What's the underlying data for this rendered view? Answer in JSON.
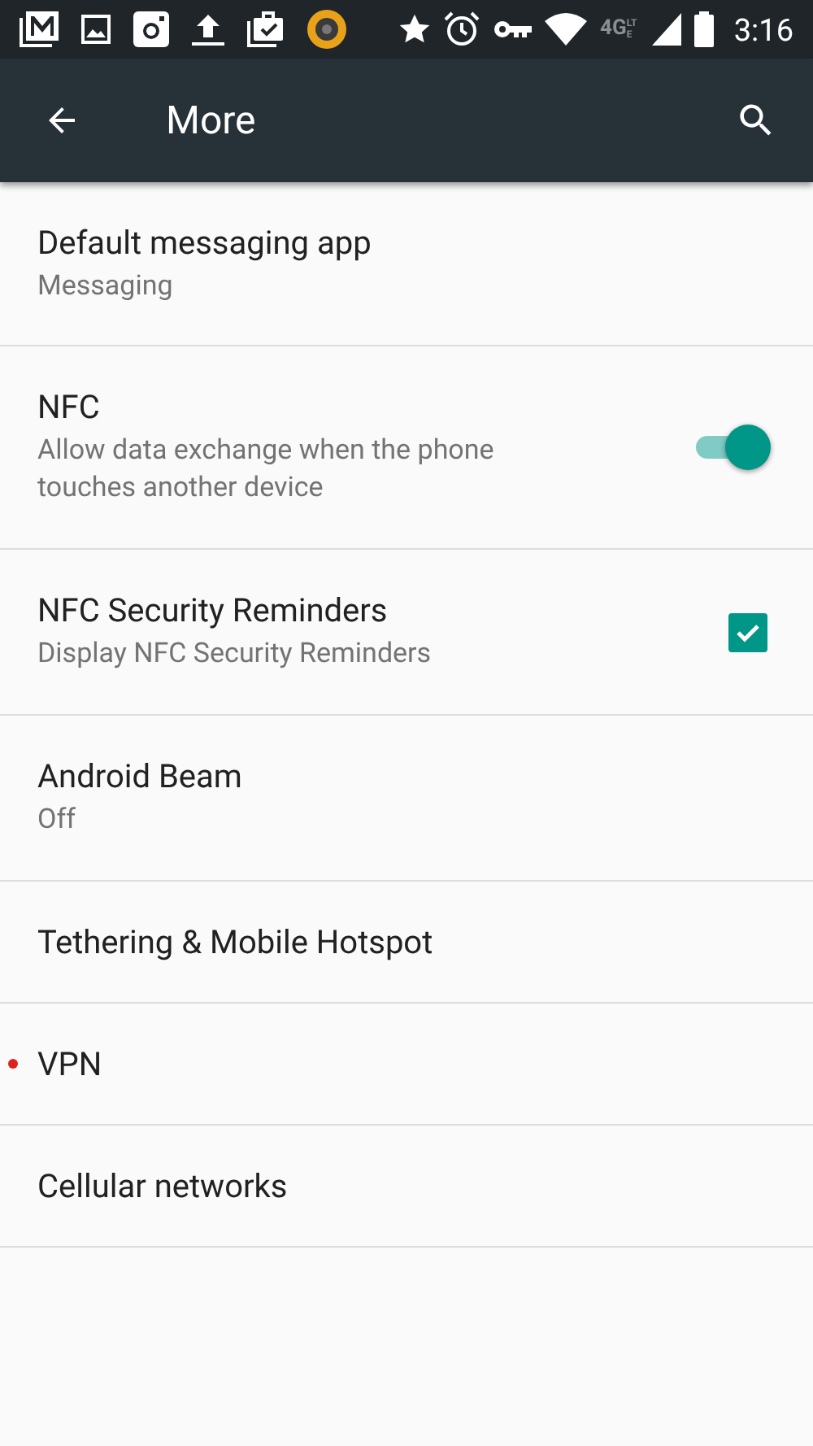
{
  "status_bar": {
    "network": "4G",
    "network_sub": "LTE",
    "time": "3:16"
  },
  "toolbar": {
    "title": "More"
  },
  "items": [
    {
      "kind": "text",
      "title": "Default messaging app",
      "summary": "Messaging",
      "alert": false
    },
    {
      "kind": "switch",
      "title": "NFC",
      "summary": "Allow data exchange when the phone touches another device",
      "on": true,
      "alert": false
    },
    {
      "kind": "checkbox",
      "title": "NFC Security Reminders",
      "summary": "Display NFC Security Reminders",
      "checked": true,
      "alert": false
    },
    {
      "kind": "text",
      "title": "Android Beam",
      "summary": "Off",
      "alert": false
    },
    {
      "kind": "text",
      "title": "Tethering & Mobile Hotspot",
      "alert": false
    },
    {
      "kind": "text",
      "title": "VPN",
      "alert": true
    },
    {
      "kind": "text",
      "title": "Cellular networks",
      "alert": false
    }
  ]
}
